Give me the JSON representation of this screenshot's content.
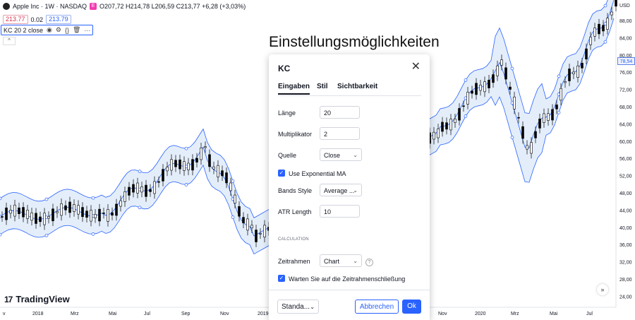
{
  "symbol": {
    "name": "Apple Inc · 1W · NASDAQ",
    "ohlc": "O207,72 H214,78 L206,59 C213,77 +6,28 (+3,03%)",
    "sell_price": "213.77",
    "spread": "0.02",
    "buy_price": "213.79",
    "earnings_badge": "E"
  },
  "indicator_legend": {
    "label": "KC 20 2 close"
  },
  "collapse_label": "^",
  "heading": "Einstellungsmöglichkeiten",
  "dialog": {
    "title": "KC",
    "close": "✕",
    "tabs": [
      "Eingaben",
      "Stil",
      "Sichtbarkeit"
    ],
    "fields": {
      "length_label": "Länge",
      "length_value": "20",
      "multiplier_label": "Multiplikator",
      "multiplier_value": "2",
      "source_label": "Quelle",
      "source_value": "Close",
      "exp_ma_label": "Use Exponential MA",
      "bands_style_label": "Bands Style",
      "bands_style_value": "Average ...",
      "atr_length_label": "ATR Length",
      "atr_length_value": "10",
      "section_label": "CALCULATION",
      "timeframe_label": "Zeitrahmen",
      "timeframe_value": "Chart",
      "wait_close_label": "Warten Sie auf die Zeitrahmenschließung"
    },
    "footer": {
      "template": "Standa...",
      "cancel": "Abbrechen",
      "ok": "Ok"
    }
  },
  "logo_text": "TradingView",
  "scroll_right": "»",
  "price_axis": {
    "currency": "USD",
    "ticks": [
      "88,00",
      "84,00",
      "80,00",
      "76,00",
      "72,00",
      "68,00",
      "64,00",
      "60,00",
      "56,00",
      "52,00",
      "48,00",
      "44,00",
      "40,00",
      "36,00",
      "32,00",
      "28,00",
      "24,00"
    ],
    "last_price_tag": "78,54"
  },
  "time_axis": {
    "left_ticks": [
      "v",
      "2018",
      "Mrz",
      "Mai",
      "Jul",
      "Sep",
      "Nov",
      "2019"
    ],
    "right_ticks": [
      "Nov",
      "2020",
      "Mrz",
      "Mai",
      "Jul"
    ]
  },
  "colors": {
    "accent": "#2962ff",
    "band_fill": "#e4eefa",
    "band_line": "#2962ff",
    "candle": "#000000"
  }
}
